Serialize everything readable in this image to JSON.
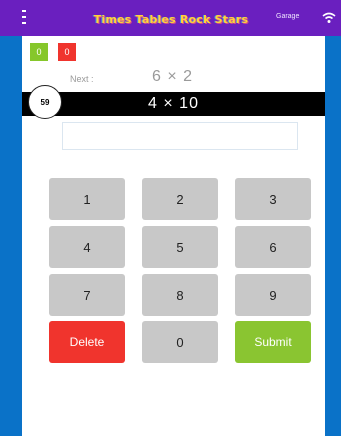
{
  "app": {
    "logo_text": "Times Tables Rock Stars",
    "topbar_link": "Garage",
    "icons": {
      "menu": "menu-icon",
      "wifi": "wifi-icon"
    },
    "colors": {
      "page_bg": "#0a72c8",
      "topbar": "#6a1fbf",
      "correct": "#86c72b",
      "incorrect": "#f0342d",
      "submit": "#8ac531",
      "key": "#c8c8c8"
    }
  },
  "score": {
    "correct": "0",
    "incorrect": "0"
  },
  "timer": {
    "seconds": "59"
  },
  "next": {
    "label": "Next :",
    "problem": "6 × 2"
  },
  "current": {
    "problem": "4 × 10"
  },
  "answer": {
    "value": "",
    "placeholder": ""
  },
  "keypad": {
    "k1": "1",
    "k2": "2",
    "k3": "3",
    "k4": "4",
    "k5": "5",
    "k6": "6",
    "k7": "7",
    "k8": "8",
    "k9": "9",
    "delete": "Delete",
    "k0": "0",
    "submit": "Submit"
  }
}
